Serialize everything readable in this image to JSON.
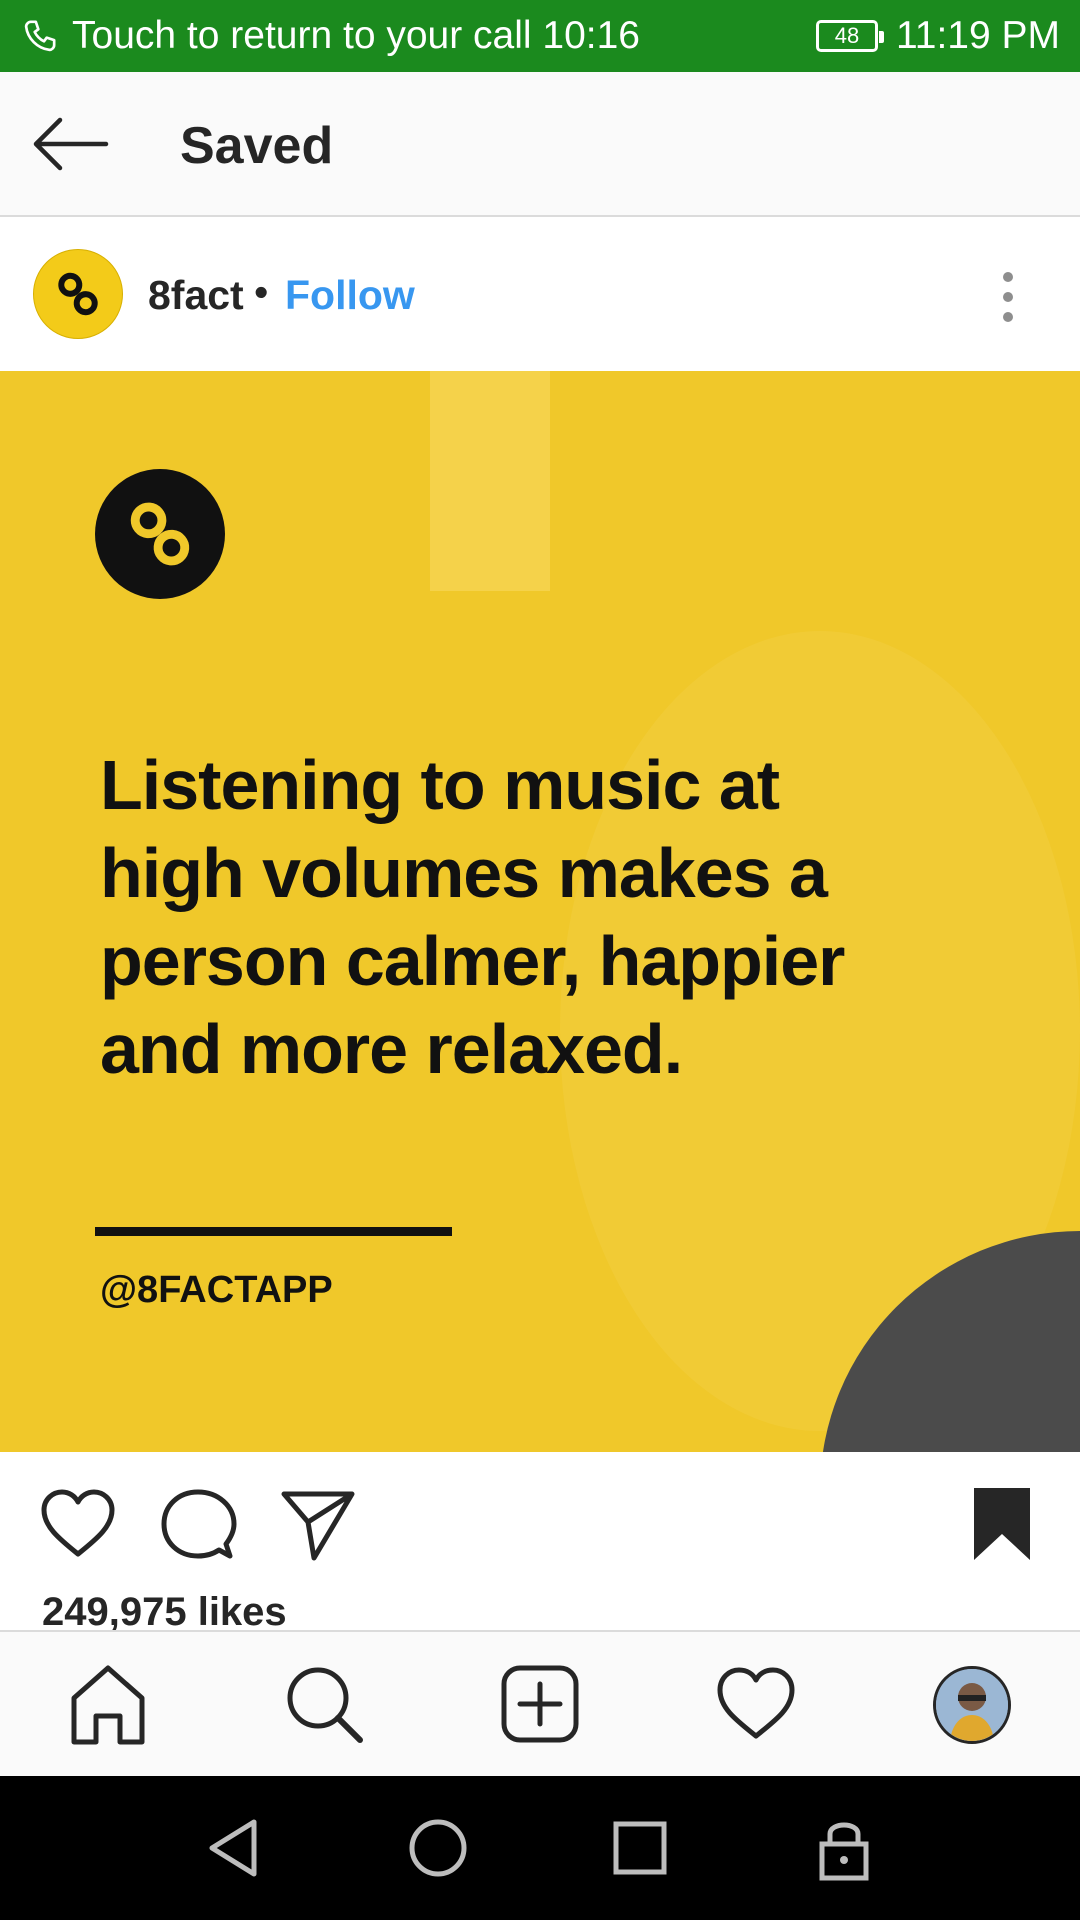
{
  "status_bar": {
    "call_text": "Touch to return to your call 10:16",
    "battery": "48",
    "time": "11:19 PM",
    "bg_color": "#1b8a1e"
  },
  "header": {
    "title": "Saved",
    "back_icon": "arrow-left-icon"
  },
  "post": {
    "username": "8fact",
    "separator": "•",
    "follow_label": "Follow",
    "image": {
      "text_line1": "Listening to music at",
      "text_line2": "high volumes makes a",
      "text_line3": "person calmer, happier",
      "text_line4": "and more relaxed.",
      "handle": "@8FACTAPP",
      "bg_color": "#f0c82a"
    },
    "likes": "249,975 likes",
    "saved": true
  },
  "actions": [
    "heart-icon",
    "comment-icon",
    "share-icon",
    "bookmark-icon"
  ],
  "bottom_nav": [
    "home-icon",
    "search-icon",
    "add-post-icon",
    "activity-heart-icon",
    "profile-avatar"
  ],
  "system_nav": [
    "back-triangle-icon",
    "home-circle-icon",
    "recents-square-icon",
    "lock-icon"
  ]
}
